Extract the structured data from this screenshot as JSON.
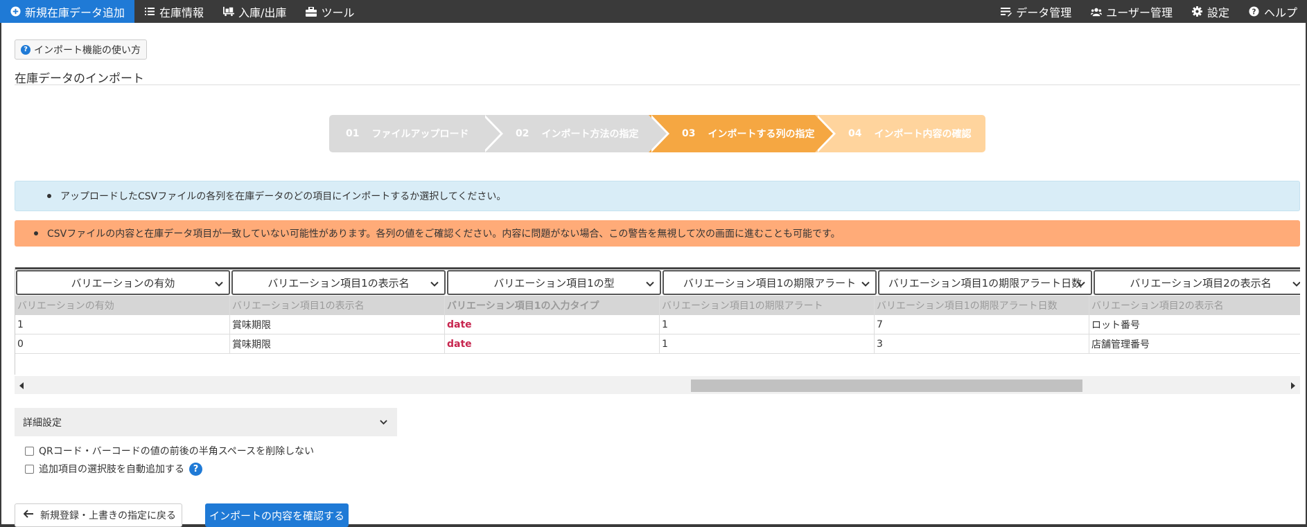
{
  "nav": {
    "left": [
      {
        "label": "新規在庫データ追加",
        "icon": "plus-circle-icon",
        "active": true
      },
      {
        "label": "在庫情報",
        "icon": "list-icon"
      },
      {
        "label": "入庫/出庫",
        "icon": "pallet-icon"
      },
      {
        "label": "ツール",
        "icon": "toolbox-icon"
      }
    ],
    "right": [
      {
        "label": "データ管理",
        "icon": "data-manage-icon"
      },
      {
        "label": "ユーザー管理",
        "icon": "users-icon"
      },
      {
        "label": "設定",
        "icon": "gear-icon"
      },
      {
        "label": "ヘルプ",
        "icon": "question-icon"
      }
    ]
  },
  "help_button": "インポート機能の使い方",
  "page_title": "在庫データのインポート",
  "steps": [
    {
      "num": "01",
      "label": "ファイルアップロード"
    },
    {
      "num": "02",
      "label": "インポート方法の指定"
    },
    {
      "num": "03",
      "label": "インポートする列の指定"
    },
    {
      "num": "04",
      "label": "インポート内容の確認"
    }
  ],
  "alerts": {
    "info": "アップロードしたCSVファイルの各列を在庫データのどの項目にインポートするか選択してください。",
    "warning": "CSVファイルの内容と在庫データ項目が一致していない可能性があります。各列の値をご確認ください。内容に問題がない場合、この警告を無視して次の画面に進むことも可能です。"
  },
  "table": {
    "selects": [
      "バリエーションの有効",
      "バリエーション項目1の表示名",
      "バリエーション項目1の型",
      "バリエーション項目1の期限アラート",
      "バリエーション項目1の期限アラート日数",
      "バリエーション項目2の表示名"
    ],
    "headers": [
      "バリエーションの有効",
      "バリエーション項目1の表示名",
      "バリエーション項目1の入力タイプ",
      "バリエーション項目1の期限アラート",
      "バリエーション項目1の期限アラート日数",
      "バリエーション項目2の表示名"
    ],
    "rows": [
      [
        "1",
        "賞味期限",
        "date",
        "1",
        "7",
        "ロット番号"
      ],
      [
        "0",
        "賞味期限",
        "date",
        "1",
        "3",
        "店舗管理番号"
      ]
    ]
  },
  "details_label": "詳細設定",
  "options": [
    "QRコード・バーコードの値の前後の半角スペースを削除しない",
    "追加項目の選択肢を自動追加する"
  ],
  "buttons": {
    "back": "新規登録・上書きの指定に戻る",
    "confirm": "インポートの内容を確認する"
  },
  "colors": {
    "primary": "#1f7ad6",
    "step_active": "#f5a742",
    "step_next": "#ffd49d",
    "warning_bg": "#ffab78",
    "info_bg": "#d9edf7"
  }
}
